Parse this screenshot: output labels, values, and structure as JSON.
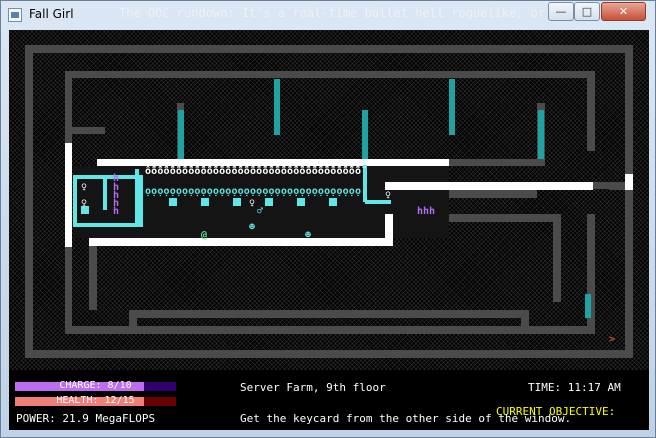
{
  "window": {
    "title": "Fall Girl",
    "title_ghost": "The OOC rundown: It's a real-time bullet hell roguelike, or at least",
    "minimize_glyph": "—",
    "maximize_glyph": "□",
    "close_glyph": "✕"
  },
  "map": {
    "ghost_glyphs": "ỗỗỗỗỗỗỗỗỗỗỗỗỗỗỗỗỗỗỗỗỗỗỗỗỗỗỗỗỗỗỗỗỗỗỗ",
    "beam_glyphs": "ọọọọọọọọọọọọọọọọọọọọọọọọọọọọọọọọọọọ",
    "enemy_hhh": "hhh",
    "h_glyph": "h",
    "player_glyph": "@",
    "exit_glyph": ">",
    "robot_glyph": "♀",
    "key_glyph": "♂",
    "face_glyph": "☻",
    "colors": {
      "wall": "#4b4b4b",
      "barrier": "#ffffff",
      "cyan": "#5fe6e6",
      "teal": "#1fa2a2",
      "purple": "#b06ef0",
      "exit": "#d24a20",
      "player": "#5fe6a0"
    }
  },
  "hud": {
    "charge": {
      "label": "CHARGE: 8/10",
      "value": 8,
      "max": 10
    },
    "health": {
      "label": "HEALTH: 12/15",
      "value": 12,
      "max": 15
    },
    "power": "POWER: 21.9 MegaFLOPS",
    "location": "Server Farm, 9th floor",
    "time": "TIME: 11:17 AM",
    "objective_title": "CURRENT OBJECTIVE:",
    "objective_text": "Get the keycard from the other side of the window."
  }
}
